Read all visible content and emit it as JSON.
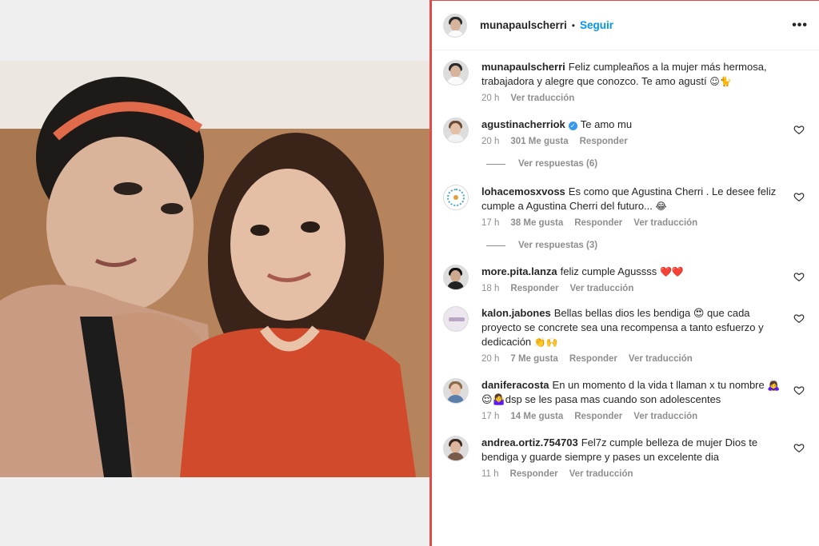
{
  "post": {
    "author": "munapaulscherri",
    "separator": "•",
    "follow_label": "Seguir",
    "more_label": "•••"
  },
  "comments": [
    {
      "user": "munapaulscherri",
      "text": "Feliz cumpleaños a la mujer más hermosa, trabajadora y alegre que conozco. Te amo agustí",
      "emoji": "☺🐈",
      "time": "20 h",
      "likes": "",
      "reply": "",
      "translate": "Ver traducción",
      "verified": false
    },
    {
      "user": "agustinacherriok",
      "text": "Te amo mu",
      "emoji": "",
      "time": "20 h",
      "likes": "301 Me gusta",
      "reply": "Responder",
      "translate": "",
      "verified": true,
      "replies_label": "Ver respuestas (6)"
    },
    {
      "user": "lohacemosxvoss",
      "text": "Es como que Agustina Cherri . Le desee feliz cumple a Agustina Cherri del futuro...",
      "emoji": "😂",
      "time": "17 h",
      "likes": "38 Me gusta",
      "reply": "Responder",
      "translate": "Ver traducción",
      "verified": false,
      "replies_label": "Ver respuestas (3)"
    },
    {
      "user": "more.pita.lanza",
      "text": "feliz cumple Agussss",
      "emoji": "❤️❤️",
      "time": "18 h",
      "likes": "",
      "reply": "Responder",
      "translate": "Ver traducción",
      "verified": false
    },
    {
      "user": "kalon.jabones",
      "text": "Bellas bellas dios les bendiga 😍 que cada proyecto se concrete sea una recompensa a tanto esfuerzo y dedicación",
      "emoji": "👏🙌",
      "time": "20 h",
      "likes": "7 Me gusta",
      "reply": "Responder",
      "translate": "Ver traducción",
      "verified": false
    },
    {
      "user": "daniferacosta",
      "text": "En un momento d la vida t llaman x tu nombre 🙇‍♀️😌🤷‍♀️dsp se les pasa mas cuando son adolescentes",
      "emoji": "",
      "time": "17 h",
      "likes": "14 Me gusta",
      "reply": "Responder",
      "translate": "Ver traducción",
      "verified": false
    },
    {
      "user": "andrea.ortiz.754703",
      "text": "Fel7z cumple belleza de mujer Dios te bendiga y guarde siempre y pases un excelente dia",
      "emoji": "",
      "time": "11 h",
      "likes": "",
      "reply": "Responder",
      "translate": "Ver traducción",
      "verified": false
    }
  ],
  "colors": {
    "accent": "#0095f6",
    "border_highlight": "#e24a4a",
    "meta_text": "#8e8e8e",
    "verified": "#3897f0",
    "heart_red": "#e0245e"
  },
  "icons": {
    "like": "heart-outline-icon",
    "more": "more-options-icon",
    "verified": "verified-badge-icon"
  }
}
